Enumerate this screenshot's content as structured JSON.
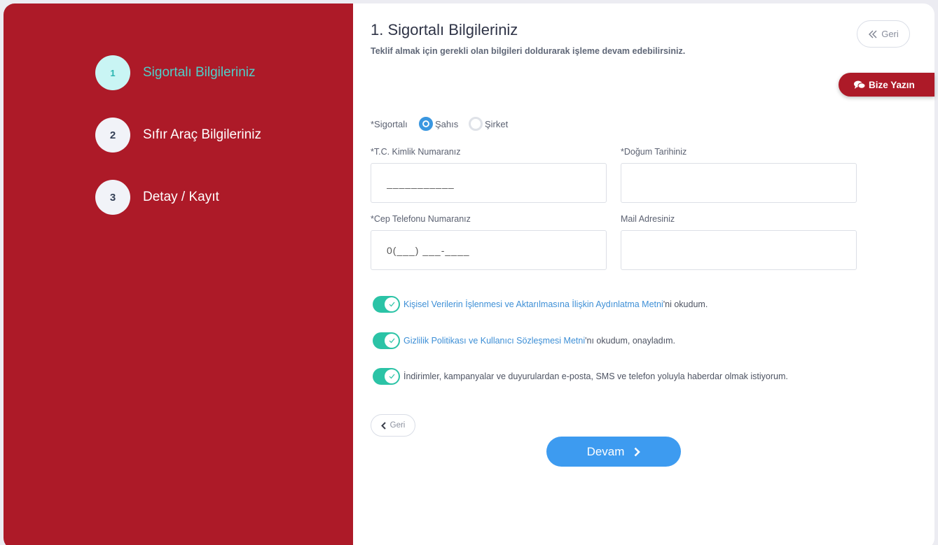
{
  "steps": [
    {
      "number": "1",
      "label": "Sigortalı Bilgileriniz",
      "active": true
    },
    {
      "number": "2",
      "label": "Sıfır Araç Bilgileriniz",
      "active": false
    },
    {
      "number": "3",
      "label": "Detay / Kayıt",
      "active": false
    }
  ],
  "header": {
    "title": "1. Sigortalı Bilgileriniz",
    "subtitle": "Teklif almak için gerekli olan bilgileri doldurarak işleme devam edebilirsiniz.",
    "back_label": "Geri"
  },
  "chat": {
    "label": "Bize Yazın",
    "icon": "chat-bubbles-icon"
  },
  "insured_type": {
    "label": "*Sigortalı",
    "options": [
      {
        "label": "Şahıs",
        "selected": true
      },
      {
        "label": "Şirket",
        "selected": false
      }
    ]
  },
  "fields": {
    "tc": {
      "label": "*T.C. Kimlik Numaranız",
      "placeholder": "___________",
      "value": ""
    },
    "birth": {
      "label": "*Doğum Tarihiniz",
      "placeholder": "",
      "value": ""
    },
    "phone": {
      "label": "*Cep Telefonu Numaranız",
      "placeholder": "0(___) ___-____",
      "value": ""
    },
    "mail": {
      "label": "Mail Adresiniz",
      "placeholder": "",
      "value": ""
    }
  },
  "consents": [
    {
      "link": "Kişisel Verilerin İşlenmesi ve Aktarılmasına İlişkin Aydınlatma Metni",
      "text": " 'ni okudum.",
      "checked": true
    },
    {
      "link": "Gizlilik Politikası ve Kullanıcı Sözleşmesi Metni",
      "text": " 'nı okudum, onayladım.",
      "checked": true
    },
    {
      "link": "",
      "text": "İndirimler, kampanyalar ve duyurulardan e-posta, SMS ve telefon yoluyla haberdar olmak istiyorum.",
      "checked": true
    }
  ],
  "actions": {
    "back_label": "Geri",
    "continue_label": "Devam"
  },
  "colors": {
    "brand_red": "#ad1a28",
    "accent_blue": "#3d9bf0",
    "toggle_green": "#2bc3a6",
    "active_step": "#4fcfc9"
  }
}
